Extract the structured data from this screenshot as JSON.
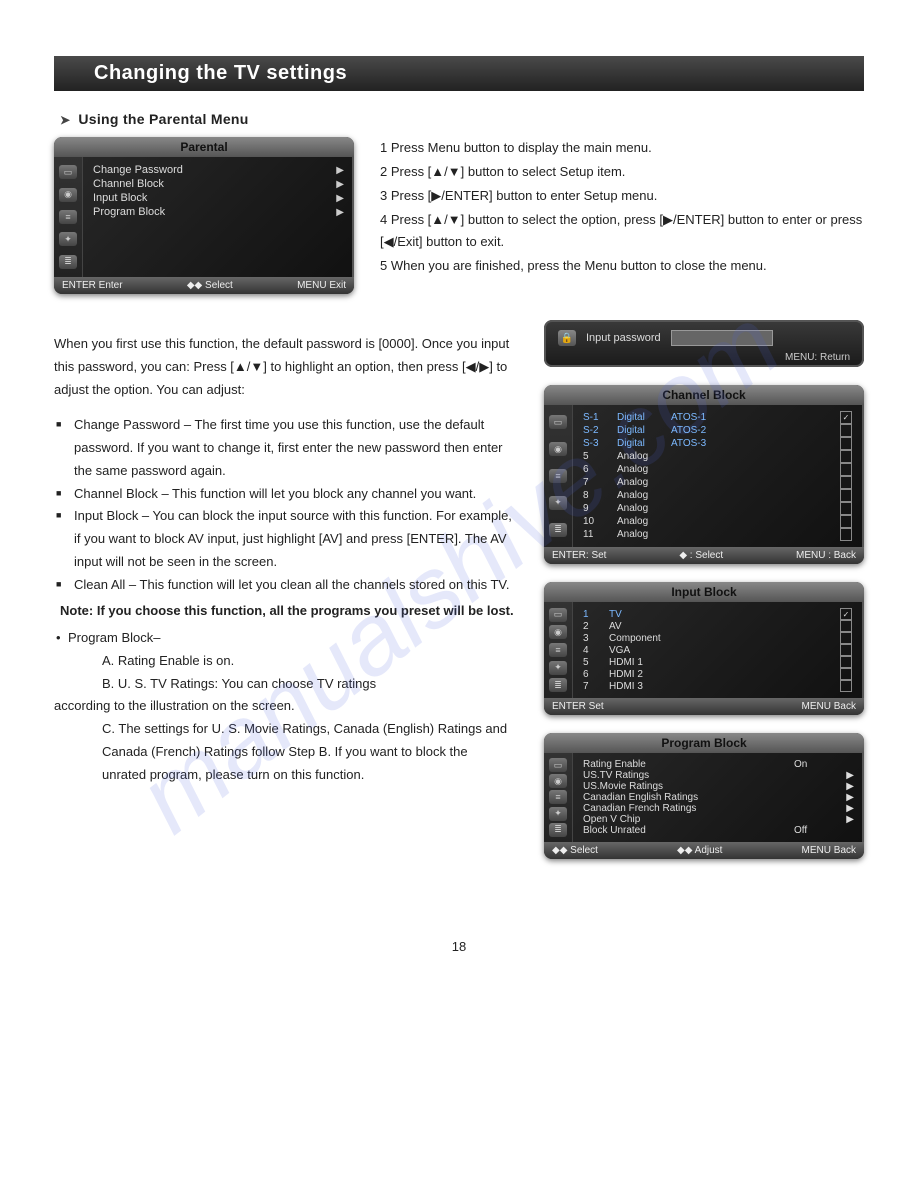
{
  "header": {
    "title": "Changing the TV settings"
  },
  "subheading": "Using the Parental Menu",
  "parental_osd": {
    "title": "Parental",
    "items": [
      "Change Password",
      "Channel Block",
      "Input Block",
      "Program Block"
    ],
    "footer": {
      "left": "ENTER Enter",
      "mid": "◆◆  Select",
      "right": "MENU Exit"
    }
  },
  "instructions": [
    "1  Press Menu button to display the main menu.",
    "2  Press [▲/▼] button to select Setup item.",
    "3  Press [▶/ENTER] button to enter Setup menu.",
    "4  Press [▲/▼] button to select the option, press [▶/ENTER] button to enter or press [◀/Exit] button to exit.",
    "5  When you are finished, press the Menu button to close the menu."
  ],
  "intro_para": "When you first use this function, the default password is [0000]. Once you input this password, you can: Press [▲/▼] to highlight an option, then press [◀/▶] to adjust the option. You can adjust:",
  "bullets": {
    "change_pw": "Change Password – The first time you use this function, use the default password. If you want to change it, first enter the new password then enter the same password again.",
    "channel_block": "Channel Block – This function will let you block any channel you want.",
    "input_block": "Input Block – You can block the input source with this function. For example, if you want to block AV input, just highlight [AV] and press [ENTER]. The AV input will not be seen in the screen.",
    "clean_all": "Clean All – This function will let you clean all the channels stored on this TV."
  },
  "note": "Note: If you choose this function, all the programs you preset will be lost.",
  "program_block_head": "Program Block–",
  "program_block": {
    "a": "A.  Rating Enable is on.",
    "b": "B.  U. S.  TV Ratings: You can choose TV ratings",
    "b_tail": "according to the illustration on the screen.",
    "c": "C.  The settings for U. S.  Movie Ratings, Canada (English) Ratings and Canada (French) Ratings follow Step B. If you want to block the unrated program, please turn on this function."
  },
  "input_pw_osd": {
    "label": "Input password",
    "footer": "MENU: Return"
  },
  "channel_block_osd": {
    "title": "Channel Block",
    "rows": [
      {
        "ch": "S-1",
        "type": "Digital",
        "name": "ATOS-1",
        "checked": true,
        "sel": true
      },
      {
        "ch": "S-2",
        "type": "Digital",
        "name": "ATOS-2",
        "checked": false,
        "sel": true
      },
      {
        "ch": "S-3",
        "type": "Digital",
        "name": "ATOS-3",
        "checked": false,
        "sel": true
      },
      {
        "ch": "5",
        "type": "Analog",
        "name": "",
        "checked": false
      },
      {
        "ch": "6",
        "type": "Analog",
        "name": "",
        "checked": false
      },
      {
        "ch": "7",
        "type": "Analog",
        "name": "",
        "checked": false
      },
      {
        "ch": "8",
        "type": "Analog",
        "name": "",
        "checked": false
      },
      {
        "ch": "9",
        "type": "Analog",
        "name": "",
        "checked": false
      },
      {
        "ch": "10",
        "type": "Analog",
        "name": "",
        "checked": false
      },
      {
        "ch": "11",
        "type": "Analog",
        "name": "",
        "checked": false
      }
    ],
    "footer": {
      "left": "ENTER: Set",
      "mid": "◆ : Select",
      "right": "MENU : Back"
    }
  },
  "input_block_osd": {
    "title": "Input Block",
    "rows": [
      {
        "n": "1",
        "label": "TV",
        "checked": true,
        "sel": true
      },
      {
        "n": "2",
        "label": "AV",
        "checked": false
      },
      {
        "n": "3",
        "label": "Component",
        "checked": false
      },
      {
        "n": "4",
        "label": "VGA",
        "checked": false
      },
      {
        "n": "5",
        "label": "HDMI 1",
        "checked": false
      },
      {
        "n": "6",
        "label": "HDMI 2",
        "checked": false
      },
      {
        "n": "7",
        "label": "HDMI 3",
        "checked": false
      }
    ],
    "footer": {
      "left": "ENTER Set",
      "right": "MENU Back"
    }
  },
  "program_block_osd": {
    "title": "Program Block",
    "rows": [
      {
        "label": "Rating Enable",
        "value": "On",
        "caret": false
      },
      {
        "label": "US.TV Ratings",
        "value": "",
        "caret": true
      },
      {
        "label": "US.Movie Ratings",
        "value": "",
        "caret": true
      },
      {
        "label": "Canadian English Ratings",
        "value": "",
        "caret": true
      },
      {
        "label": "Canadian French Ratings",
        "value": "",
        "caret": true
      },
      {
        "label": "Open V Chip",
        "value": "",
        "caret": true
      },
      {
        "label": "Block Unrated",
        "value": "Off",
        "caret": false
      }
    ],
    "footer": {
      "left": "◆◆  Select",
      "mid": "◆◆  Adjust",
      "right": "MENU  Back"
    }
  },
  "page_number": "18",
  "watermark": "manualshive.com"
}
